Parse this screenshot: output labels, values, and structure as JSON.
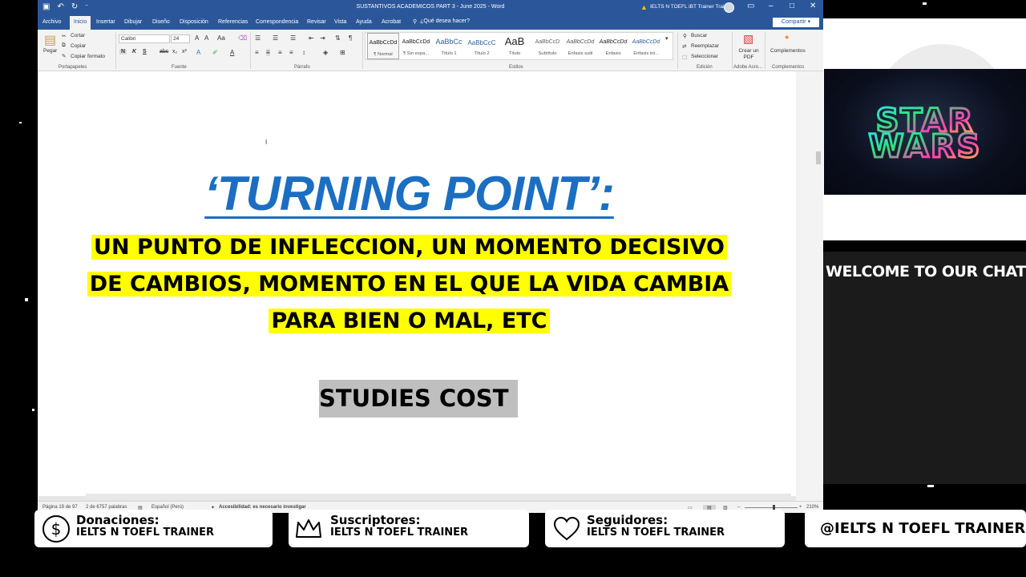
{
  "titlebar": {
    "doc_title": "SUSTANTIVOS ACADEMICOS PART 3 - June 2025  -  Word",
    "account": "IELTS N TOEFL iBT Trainer Trainer",
    "qat_icons": [
      "save-icon",
      "undo-icon",
      "redo-icon",
      "customize-icon"
    ]
  },
  "tabs": [
    "Archivo",
    "Inicio",
    "Insertar",
    "Dibujar",
    "Diseño",
    "Disposición",
    "Referencias",
    "Correspondencia",
    "Revisar",
    "Vista",
    "Ayuda",
    "Acrobat"
  ],
  "tell_me": "¿Qué desea hacer?",
  "share_label": "Compartir",
  "ribbon": {
    "clipboard": {
      "paste": "Pegar",
      "cut": "Cortar",
      "copy": "Copiar",
      "format_painter": "Copiar formato",
      "label": "Portapapeles"
    },
    "font": {
      "name": "Calibri",
      "size": "24",
      "bold": "N",
      "italic": "K",
      "underline": "S",
      "label": "Fuente"
    },
    "paragraph": {
      "label": "Párrafo"
    },
    "styles": {
      "label": "Estilos",
      "items": [
        {
          "preview": "AaBbCcDd",
          "name": "¶ Normal"
        },
        {
          "preview": "AaBbCcDd",
          "name": "¶ Sin espa..."
        },
        {
          "preview": "AaBbCc",
          "name": "Título 1"
        },
        {
          "preview": "AaBbCcC",
          "name": "Título 2"
        },
        {
          "preview": "AaB",
          "name": "Título"
        },
        {
          "preview": "AaBbCcD",
          "name": "Subtítulo"
        },
        {
          "preview": "AaBbCcDd",
          "name": "Énfasis sutil"
        },
        {
          "preview": "AaBbCcDd",
          "name": "Énfasis"
        },
        {
          "preview": "AaBbCcDd",
          "name": "Énfasis int..."
        }
      ]
    },
    "editing": {
      "find": "Buscar",
      "replace": "Reemplazar",
      "select": "Seleccionar",
      "label": "Edición"
    },
    "adobe": {
      "create_pdf": "Crear un PDF",
      "label": "Adobe Acro..."
    },
    "addins": {
      "button": "Complementos",
      "label": "Complementos"
    }
  },
  "document": {
    "headline": "‘TURNING POINT’:",
    "meaning_lines": [
      "UN PUNTO DE INFLECCION, UN MOMENTO DECISIVO",
      "DE CAMBIOS, MOMENTO EN EL QUE LA VIDA CAMBIA",
      "PARA BIEN O MAL, ETC"
    ],
    "subheading": "STUDIES COST"
  },
  "statusbar": {
    "page": "Página 19 de 97",
    "words": "2 de 6757 palabras",
    "language": "Español (Perú)",
    "accessibility": "Accesibilidad: es necesario investigar",
    "zoom": "210%"
  },
  "overlay": {
    "star_wars": [
      "STAR",
      "WARS"
    ],
    "chat_welcome": "WELCOME TO OUR CHAT"
  },
  "banner": {
    "donations": {
      "title": "Donaciones:",
      "name": "IELTS N TOEFL TRAINER",
      "icon": "dollar-icon"
    },
    "subscribers": {
      "title": "Suscriptores:",
      "name": "IELTS N TOEFL TRAINER",
      "icon": "crown-icon"
    },
    "followers": {
      "title": "Seguidores:",
      "name": "IELTS N TOEFL TRAINER",
      "icon": "heart-icon"
    },
    "handle": "@IELTS N TOEFL TRAINER"
  },
  "colors": {
    "word_blue": "#2b579a",
    "headline_blue": "#1b6ec2",
    "highlight_yellow": "#ffff00",
    "subheading_gray": "#bfbfbf"
  }
}
